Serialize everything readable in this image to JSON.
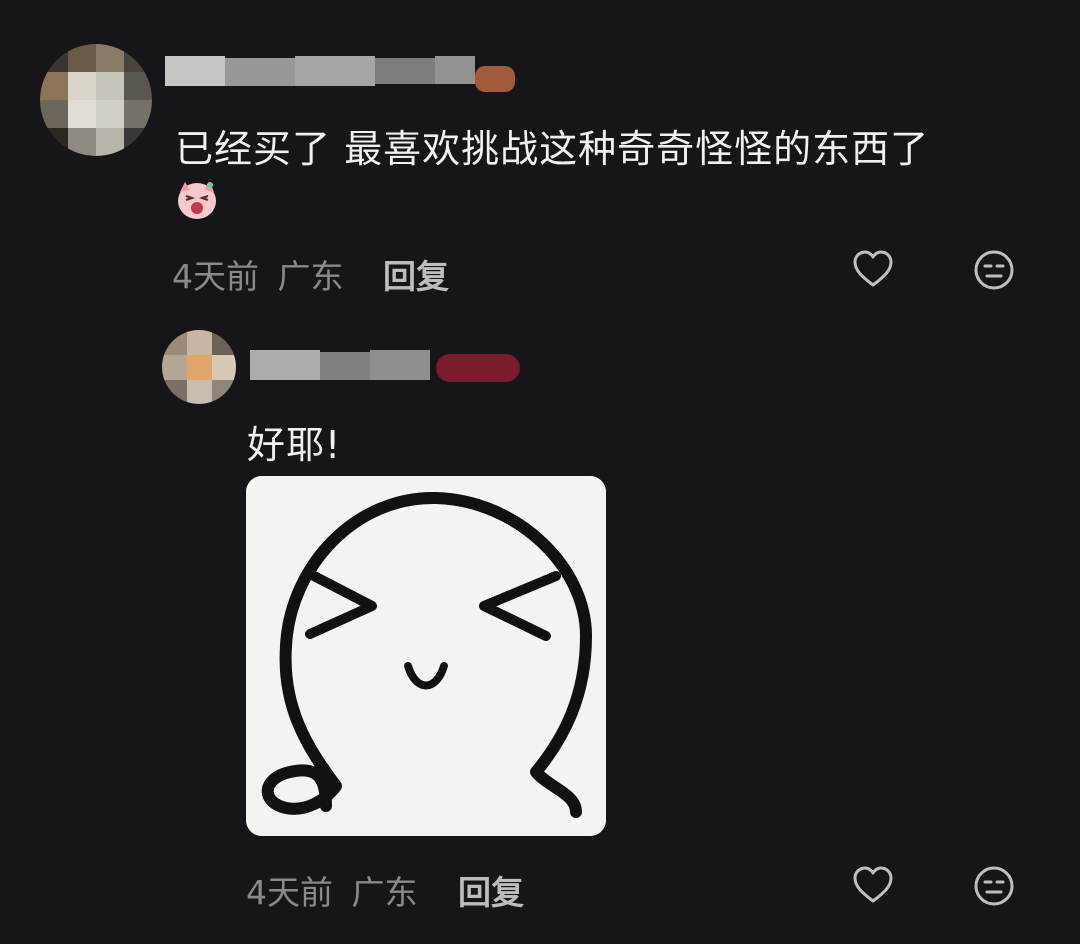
{
  "comments": [
    {
      "text": "已经买了 最喜欢挑战这种奇奇怪怪的东西了",
      "time": "4天前",
      "location": "广东",
      "reply_label": "回复",
      "emoji": "laughing-pink-sticker-emoji"
    },
    {
      "text": "好耶!",
      "time": "4天前",
      "location": "广东",
      "reply_label": "回复",
      "sticker": "squinting-white-blob-sticker"
    }
  ],
  "icons": {
    "like": "heart-outline-icon",
    "dislike": "neutral-face-icon"
  },
  "colors": {
    "background": "#16161a",
    "text": "#f0f0f0",
    "meta": "#8a8a8e",
    "reply": "#bdbdc1",
    "badge": "#7a1c2c"
  }
}
